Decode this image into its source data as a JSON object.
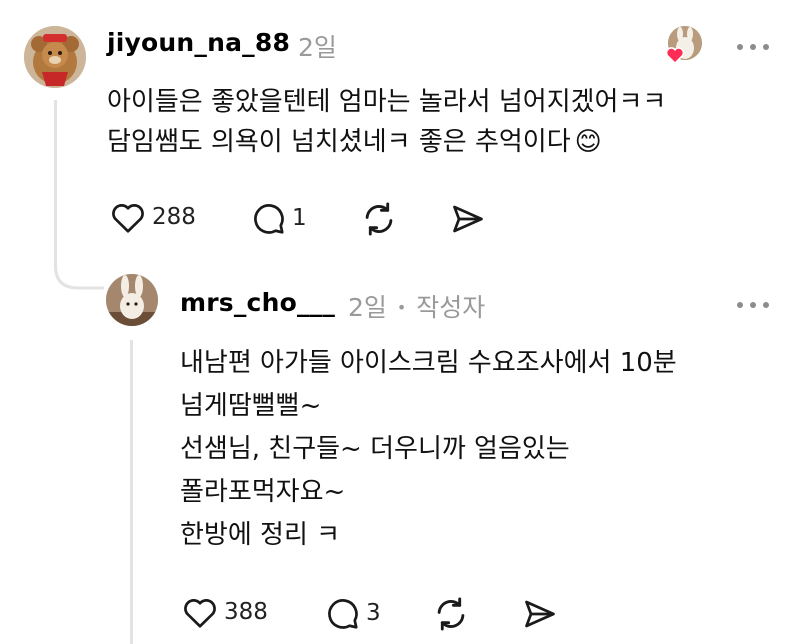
{
  "comment": {
    "username": "jiyoun_na_88",
    "time": "2일",
    "lines": [
      "아이들은 좋았을텐테 엄마는 놀라서 넘어지겠어ㅋㅋ",
      "담임쌤도 의욕이 넘치셨네ㅋ 좋은 추억이다"
    ],
    "emoji": "😊",
    "likes": "288",
    "replies": "1"
  },
  "reply": {
    "username": "mrs_cho___",
    "time": "2일",
    "separator": "•",
    "author_tag": "작성자",
    "lines": [
      "내남편 아가들 아이스크림 수요조사에서 10분",
      "넘게땀뻘뻘~",
      "선샘님, 친구들~ 더우니까 얼음있는",
      "폴라포먹자요~",
      "한방에 정리 ㅋ"
    ],
    "likes": "388",
    "replies": "3"
  },
  "icons": {
    "like": "heart-icon",
    "reply": "speech-bubble-icon",
    "repost": "repost-icon",
    "share": "send-icon",
    "more": "more-dots-icon",
    "liked_by_author": "heart-badge-icon"
  },
  "colors": {
    "text": "#000000",
    "muted": "#9a9a9a",
    "thread_line": "#e3e3e3",
    "heart_badge": "#ff2d55"
  }
}
